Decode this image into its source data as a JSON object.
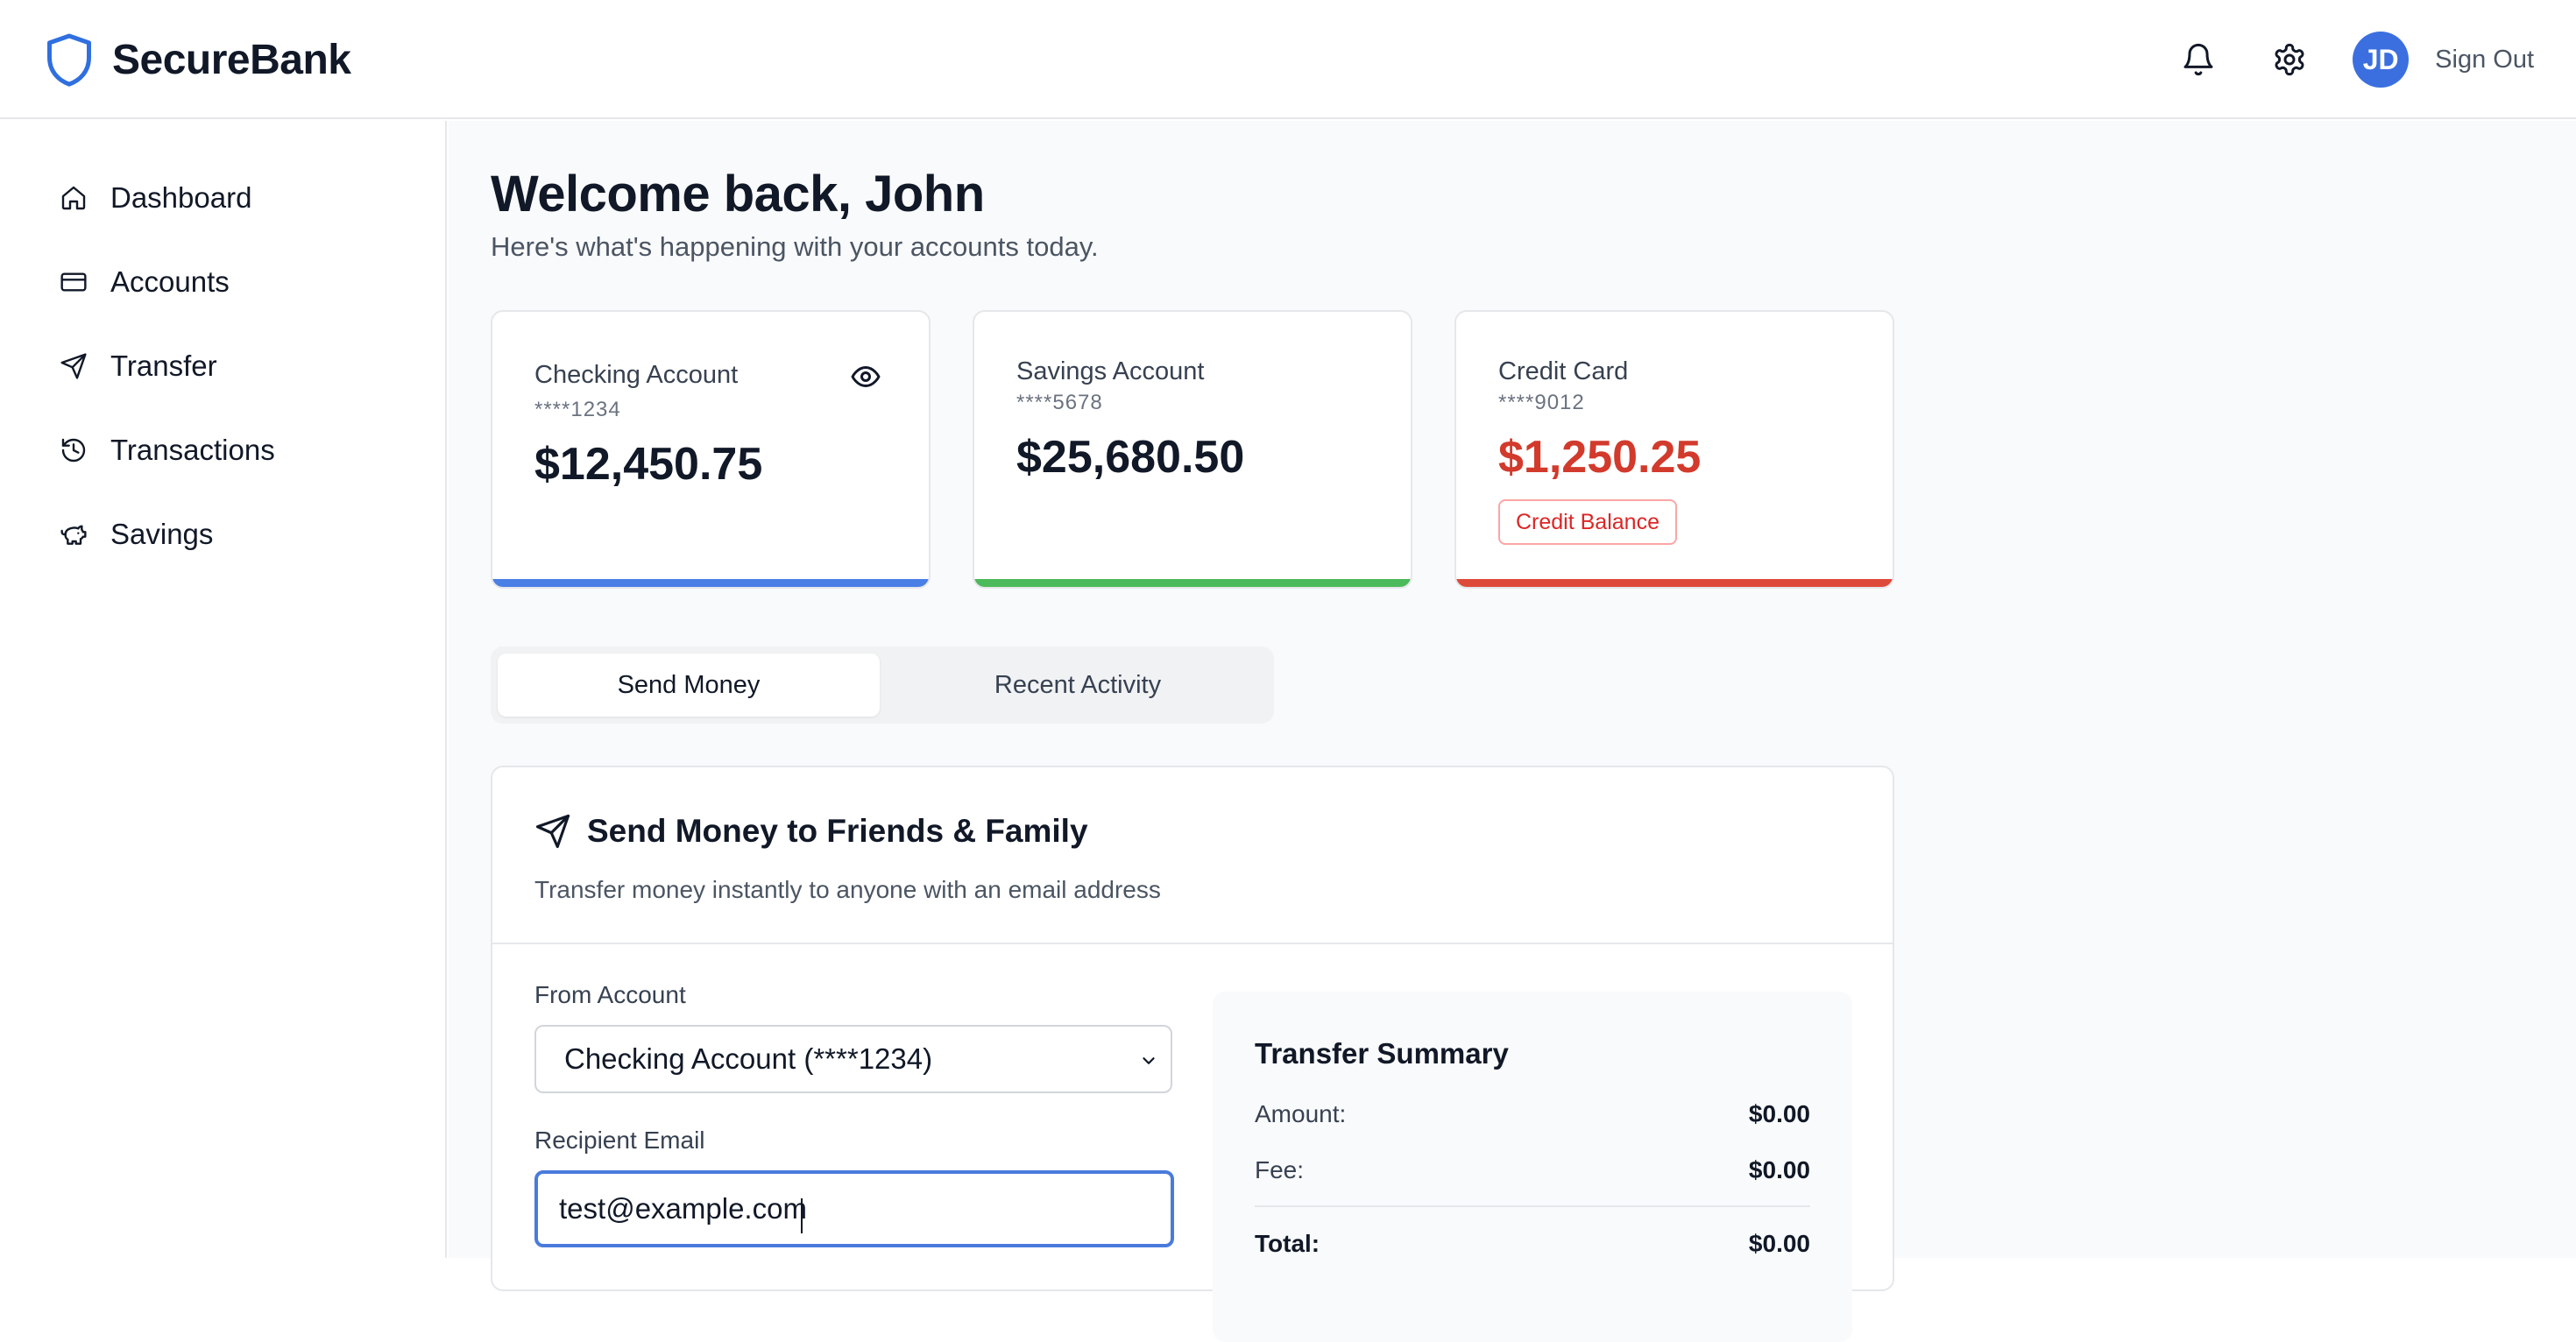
{
  "brand": {
    "name": "SecureBank"
  },
  "header": {
    "avatar_initials": "JD",
    "signout_label": "Sign Out"
  },
  "sidebar": {
    "items": [
      {
        "label": "Dashboard"
      },
      {
        "label": "Accounts"
      },
      {
        "label": "Transfer"
      },
      {
        "label": "Transactions"
      },
      {
        "label": "Savings"
      }
    ]
  },
  "main": {
    "welcome": "Welcome back, John",
    "subtitle": "Here's what's happening with your accounts today."
  },
  "accounts": [
    {
      "name": "Checking Account",
      "number": "****1234",
      "balance": "$12,450.75",
      "accent": "#4a7fe6"
    },
    {
      "name": "Savings Account",
      "number": "****5678",
      "balance": "$25,680.50",
      "accent": "#4cba5a"
    },
    {
      "name": "Credit Card",
      "number": "****9012",
      "balance": "$1,250.25",
      "accent": "#de4a3a",
      "badge": "Credit Balance"
    }
  ],
  "tabs": [
    {
      "label": "Send Money",
      "active": true
    },
    {
      "label": "Recent Activity",
      "active": false
    }
  ],
  "send_panel": {
    "title": "Send Money to Friends & Family",
    "description": "Transfer money instantly to anyone with an email address",
    "from_label": "From Account",
    "from_value": "Checking Account (****1234)",
    "recipient_label": "Recipient Email",
    "recipient_value": "test@example.com"
  },
  "summary": {
    "title": "Transfer Summary",
    "amount_label": "Amount:",
    "amount_value": "$0.00",
    "fee_label": "Fee:",
    "fee_value": "$0.00",
    "total_label": "Total:",
    "total_value": "$0.00"
  },
  "colors": {
    "primary": "#3b6fe0",
    "credit_red": "#dc2626",
    "focus_ring": "#4a7bdc"
  }
}
